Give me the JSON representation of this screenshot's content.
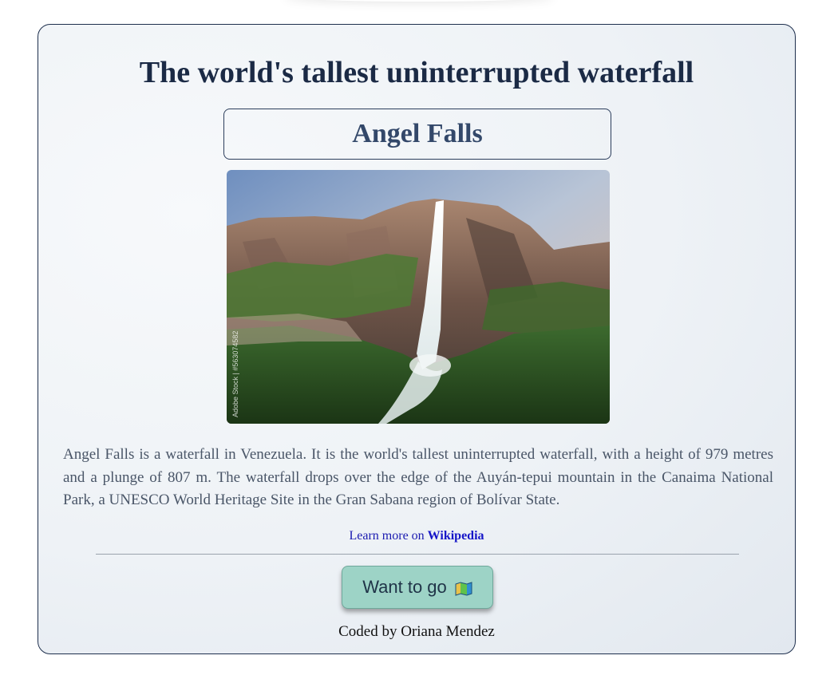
{
  "page": {
    "title": "The world's tallest uninterrupted waterfall"
  },
  "card": {
    "name": "Angel Falls",
    "image_watermark": "Adobe Stock | #563074582",
    "description": "Angel Falls is a waterfall in Venezuela. It is the world's tallest uninterrupted waterfall, with a height of 979 metres and a plunge of 807 m. The waterfall drops over the edge of the Auyán-tepui mountain in the Canaima National Park, a UNESCO World Heritage Site in the Gran Sabana region of Bolívar State.",
    "learn_more_prefix": "Learn more on ",
    "learn_more_link": "Wikipedia",
    "button_label": "Want to go",
    "button_icon": "map-icon",
    "credit": "Coded by Oriana Mendez"
  },
  "colors": {
    "title": "#1b2a45",
    "subtitle": "#33486a",
    "button_bg": "#9dd3c6",
    "link": "#1515c8",
    "border": "#1e2f4d"
  }
}
